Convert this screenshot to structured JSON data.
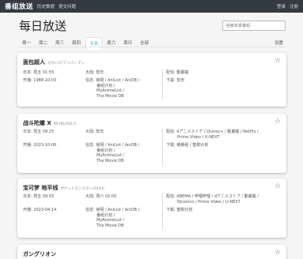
{
  "nav": {
    "brand": "番组放送",
    "links": [
      "历史数据",
      "提交问题"
    ],
    "right": [
      "登录",
      "注册"
    ]
  },
  "page": {
    "title": "每日放送",
    "search_placeholder": "检索本季番组",
    "settings_label": "设置"
  },
  "tabs": [
    "周一",
    "周二",
    "周三",
    "周四",
    "今天",
    "周六",
    "周日",
    "全部"
  ],
  "active_tab_index": 4,
  "cards": [
    {
      "title": "面包超人",
      "original": "それいけ!アンパンマン",
      "japan": "日本: 周五 01:55",
      "start": "开播: 1988-10-03",
      "mainland": "大陆: 暂无",
      "info": [
        "信息: 官网 / AniList / AniDB /",
        "番组计划 /",
        "MyAnimeList /",
        "The Movie DB"
      ],
      "distribution": [
        "配信: 動畫瘋"
      ],
      "download": "下载: 暂无"
    },
    {
      "title": "战斗陀螺 X",
      "original": "BEYBLADE X",
      "japan": "日本: 周五 09:25",
      "start": "开播: 2023-10-06",
      "mainland": "大陆: 暂无",
      "info": [
        "信息: 官网 / AniList / AniDB /",
        "番组计划 /",
        "MyAnimeList /",
        "The Movie DB"
      ],
      "distribution": [
        "配信: dアニメストア / Disney+ / 動畫瘋 / Netflix /",
        "Prime Video / U-NEXT"
      ],
      "download": "下载: 萌番组 / 蜜柑计划"
    },
    {
      "title": "宝可梦 地平线",
      "original": "ポケットモンスター(2023)",
      "japan": "日本: 周五 09:55",
      "start": "开播: 2023-04-14",
      "mainland": "大陆: 周六 02:00",
      "info": [
        "信息: 官网 / AniList / AniDB /",
        "番组计划 /",
        "MyAnimeList /",
        "The Movie DB"
      ],
      "distribution": [
        "配信: ABEMA / 哔哩哔哩 / dアニメストア / 動畫瘋 /",
        "Niconico / Prime Video / U-NEXT"
      ],
      "download": "下载: 蜜柑计划"
    },
    {
      "title": "ガングリオン",
      "original": ""
    }
  ]
}
